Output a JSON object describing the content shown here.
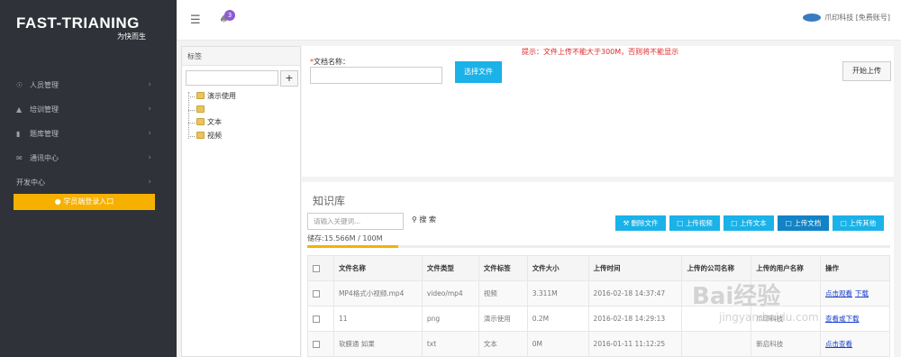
{
  "brand": {
    "name_part1": "FAST-T",
    "name_part2": "RIANING",
    "slogan": "为快而生"
  },
  "sidebar": {
    "items": [
      {
        "label": "人员管理",
        "icon": "bank-icon"
      },
      {
        "label": "培训管理",
        "icon": "graduation-cap-icon"
      },
      {
        "label": "题库管理",
        "icon": "book-icon"
      },
      {
        "label": "通讯中心",
        "icon": "envelope-icon"
      },
      {
        "label": "开发中心",
        "icon": ""
      }
    ],
    "login_button": "学员端登录入口"
  },
  "header": {
    "badge_count": "3",
    "account": "爪印科技 [免费账号]"
  },
  "tree": {
    "title": "标签",
    "nodes": [
      "演示使用",
      "",
      "文本",
      "视频"
    ]
  },
  "upload": {
    "doc_label": "文档名称：",
    "required_mark": "*",
    "choose_button": "选择文件",
    "tip": "提示：文件上传不能大于300M，否则将不能显示",
    "start_button": "开始上传"
  },
  "kb": {
    "title": "知识库",
    "search_placeholder": "请输入关键词...",
    "search_button": "搜 索",
    "storage": "储存:15.566M / 100M",
    "storage_fraction": 0.156,
    "actions": {
      "delete": "删除文件",
      "upload_video": "上传视频",
      "upload_text": "上传文本",
      "upload_doc": "上传文档",
      "upload_other": "上传其他"
    },
    "columns": [
      "文件名称",
      "文件类型",
      "文件标签",
      "文件大小",
      "上传时间",
      "上传的公司名称",
      "上传的用户名称",
      "操作"
    ],
    "rows": [
      {
        "name": "MP4格式小视频.mp4",
        "type": "video/mp4",
        "tag": "视频",
        "size": "3.311M",
        "time": "2016-02-18 14:37:47",
        "company": "",
        "user": "",
        "actions": [
          "点击观看",
          "下载"
        ]
      },
      {
        "name": "11",
        "type": "png",
        "tag": "演示使用",
        "size": "0.2M",
        "time": "2016-02-18 14:29:13",
        "company": "",
        "user": "爪印科技",
        "actions": [
          "查看或下载"
        ]
      },
      {
        "name": "软膜通 如果",
        "type": "txt",
        "tag": "文本",
        "size": "0M",
        "time": "2016-01-11 11:12:25",
        "company": "",
        "user": "新启科技",
        "actions": [
          "点击查看"
        ]
      }
    ]
  },
  "watermark": {
    "top": "Bai经验",
    "bottom": "jingyan.baidu.com"
  }
}
